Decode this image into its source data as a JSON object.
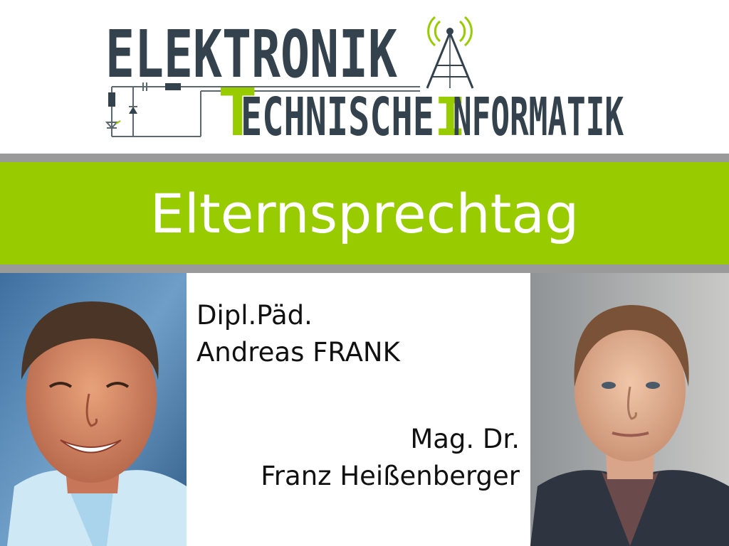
{
  "logo": {
    "line1": "ELEKTRONIK",
    "line2": "TECHNISCHE INFORMATIK",
    "line2_part1": "ECHNISCHE",
    "line2_part2": "NFORMATIK",
    "icon": "radio-tower-icon",
    "circuit": "circuit-schematic-icon"
  },
  "banner": {
    "title": "Elternsprechtag"
  },
  "teachers": [
    {
      "title": "Dipl.Päd.",
      "name": "Andreas FRANK"
    },
    {
      "title": "Mag. Dr.",
      "name": "Franz Heißenberger"
    }
  ],
  "colors": {
    "accent_green": "#99cc00",
    "logo_dark": "#33424d",
    "rule_gray": "#9a9a9a",
    "text": "#111111"
  }
}
